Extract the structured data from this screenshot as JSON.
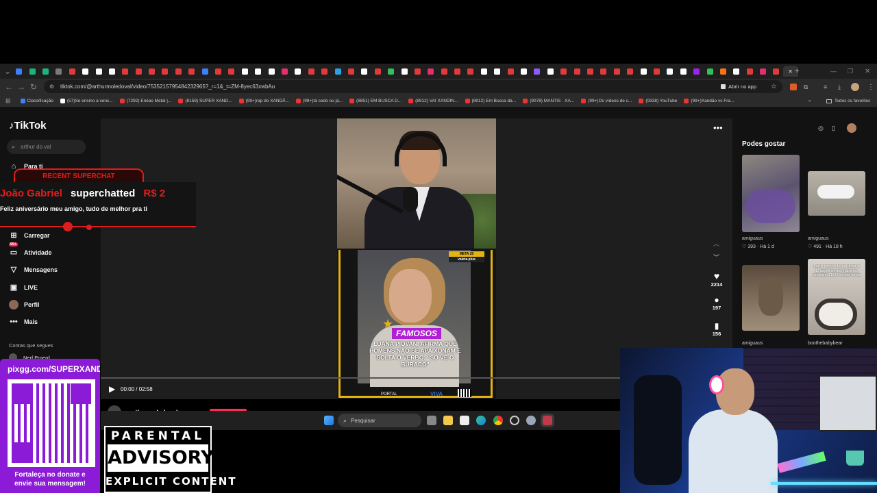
{
  "browser": {
    "url": "tiktok.com/@arthurmoledoval/video/7535215795484232965?_r=1&_t=ZM-8yec63xwbAu",
    "open_in_app": "Abrir no app",
    "bookmarks": [
      "Classificação",
      "(57)Se ensino a venc...",
      "(7292) Enéas Metal |...",
      "(8159) SUPER XAND...",
      "(99+)rap do XANDÃ...",
      "(99+)tá cedo ou já...",
      "(8851) EM BUSCA D...",
      "(8912) VAI XANDIN...",
      "(8912) Em Busca da...",
      "(9078) MANTIS · XA...",
      "(99+)Os vídeos de c...",
      "(9338) YouTube",
      "(99+)Xandão vs Fra..."
    ],
    "all_bookmarks": "Todos os favoritos",
    "tab_colors": [
      "#3b82f6",
      "#1fb37c",
      "#1fb37c",
      "#7a7a7a",
      "#e03a3a",
      "#ffffff",
      "#ffffff",
      "#ffffff",
      "#e03a3a",
      "#e03a3a",
      "#e03a3a",
      "#e03a3a",
      "#e03a3a",
      "#e03a3a",
      "#3b82f6",
      "#e03a3a",
      "#e03a3a",
      "#ffffff",
      "#ffffff",
      "#ffffff",
      "#e1306c",
      "#ffffff",
      "#e03a3a",
      "#e03a3a",
      "#2aa3e0",
      "#e03a3a",
      "#ffffff",
      "#e03a3a",
      "#32c05a",
      "#ffffff",
      "#e03a3a",
      "#e1306c",
      "#e03a3a",
      "#e03a3a",
      "#e03a3a",
      "#ffffff",
      "#ffffff",
      "#e03a3a",
      "#ffffff",
      "#8b5cf6",
      "#ffffff",
      "#e03a3a",
      "#e03a3a",
      "#e03a3a",
      "#e03a3a",
      "#e03a3a",
      "#e03a3a",
      "#ffffff",
      "#e03a3a",
      "#ffffff",
      "#ffffff",
      "#a020f0",
      "#32c05a",
      "#f97316",
      "#ffffff",
      "#e03a3a",
      "#e1306c",
      "#e03a3a"
    ]
  },
  "tiktok": {
    "brand": "TikTok",
    "search_value": "arthur do val",
    "nav": {
      "for_you": "Para ti",
      "upload": "Carregar",
      "activity": "Atividade",
      "activity_badge": "99+",
      "messages": "Mensagens",
      "live": "LIVE",
      "profile": "Perfil",
      "more": "Mais"
    },
    "following_header": "Contas que segues",
    "following_first": "Nerf Proerd",
    "video": {
      "time": "00:00 / 02:58",
      "author": "arthurmoledoval",
      "likes": "2214",
      "comments": "197",
      "saves": "156",
      "overlay_tag": "FAMOSOS",
      "overlay_headline": "LUANA PIOVANI AFIRMA QUE HOMENS NÃO SE APAIXONAM E SOLTA O VERBO: \"SÓ VÊ O BURACO\"",
      "corner_badge_top": "META 20",
      "corner_badge_bottom": "valeta.plus",
      "bottom_left": "PORTAL",
      "bottom_mid": "VIVA"
    },
    "suggestions": {
      "header": "Podes gostar",
      "items": [
        {
          "user": "amiguaus",
          "likes": "393",
          "age": "Há 1 d"
        },
        {
          "user": "amiguaus",
          "likes": "491",
          "age": "Há 18 h"
        },
        {
          "user": "amiguaus",
          "likes": "",
          "age": ""
        },
        {
          "user": "boothebabybear",
          "likes": "",
          "age": ""
        }
      ],
      "thumb4_text": "Boo is going to be put down in 12 days if we don't raise the remaining $1890 needed for his"
    }
  },
  "taskbar": {
    "search": "Pesquisar"
  },
  "overlays": {
    "superchat_title": "RECENT SUPERCHAT",
    "superchat_name": "João Gabriel",
    "superchat_action": "superchatted",
    "superchat_amount": "R$ 2",
    "superchat_message": "Feliz aniversário meu amigo, tudo de melhor pra ti",
    "qr_url": "pixgg.com/SUPERXAND",
    "qr_caption": "Fortaleça no donate e envie sua mensagem!",
    "advisory_top": "PARENTAL",
    "advisory_mid": "ADVISORY",
    "advisory_bottom": "EXPLICIT CONTENT"
  }
}
